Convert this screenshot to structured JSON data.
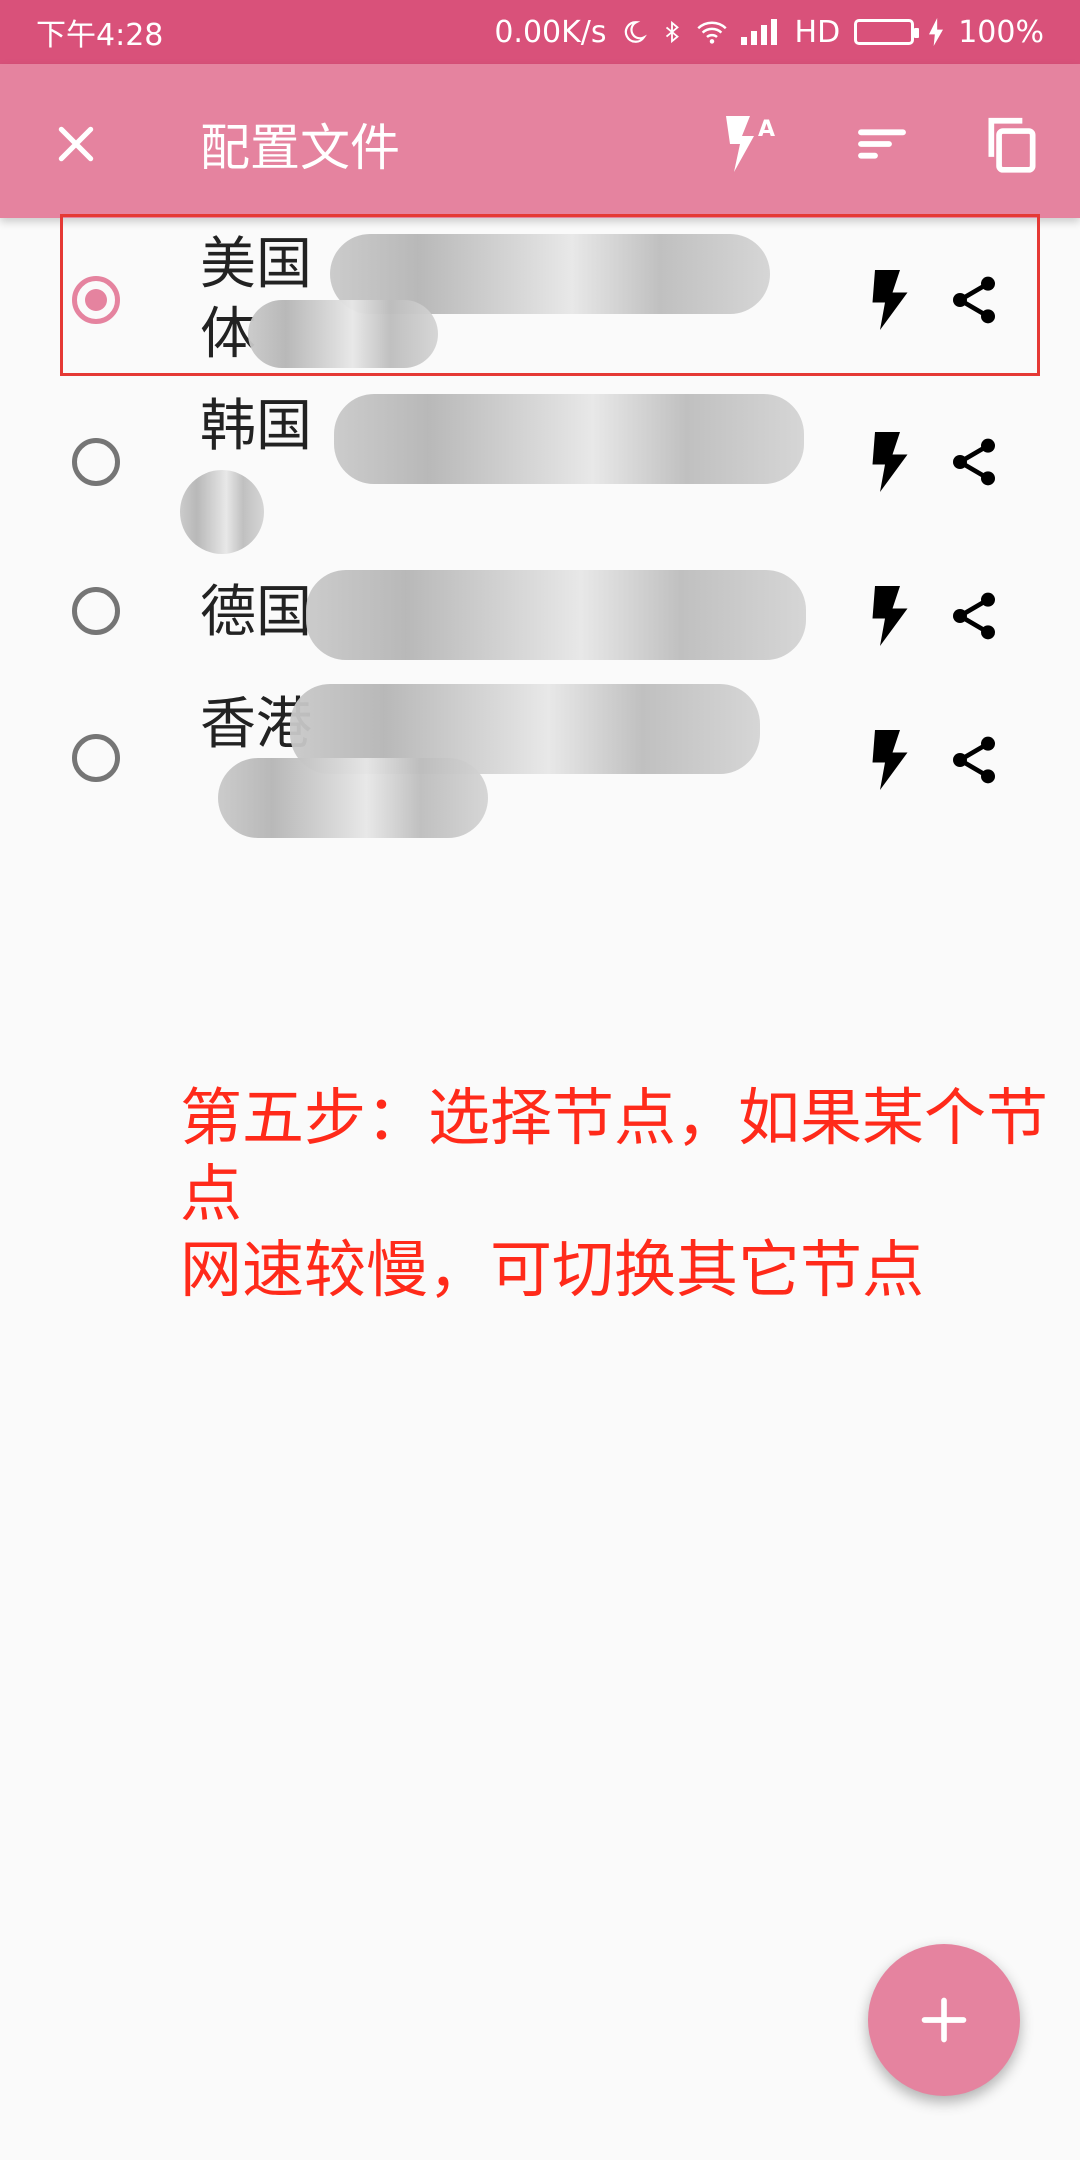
{
  "status_bar": {
    "time": "下午4:28",
    "network_speed": "0.00K/s",
    "signal_label": "HD",
    "battery": "100%",
    "battery_level": 1.0,
    "icons": [
      "moon-icon",
      "bluetooth-icon",
      "wifi-icon",
      "signal-icon",
      "battery-icon",
      "charging-icon"
    ]
  },
  "app_bar": {
    "title": "配置文件",
    "close_icon": "close-icon",
    "actions": [
      "flash-auto-icon",
      "sort-icon",
      "copy-icon"
    ]
  },
  "profiles": [
    {
      "name": "美国",
      "name_line2": "体",
      "selected": true
    },
    {
      "name": "韩国",
      "name_line2": "",
      "selected": false
    },
    {
      "name": "德国",
      "name_line2": "",
      "selected": false
    },
    {
      "name": "香港",
      "name_line2": "",
      "selected": false
    }
  ],
  "annotation": "第五步：选择节点，如果某个节点\n网速较慢，可切换其它节点",
  "fab": {
    "icon": "plus-icon",
    "label": "+"
  },
  "colors": {
    "status_bar": "#d9517a",
    "app_bar": "#e5839f",
    "annotation": "#ff2a1a",
    "highlight": "#e53935"
  }
}
